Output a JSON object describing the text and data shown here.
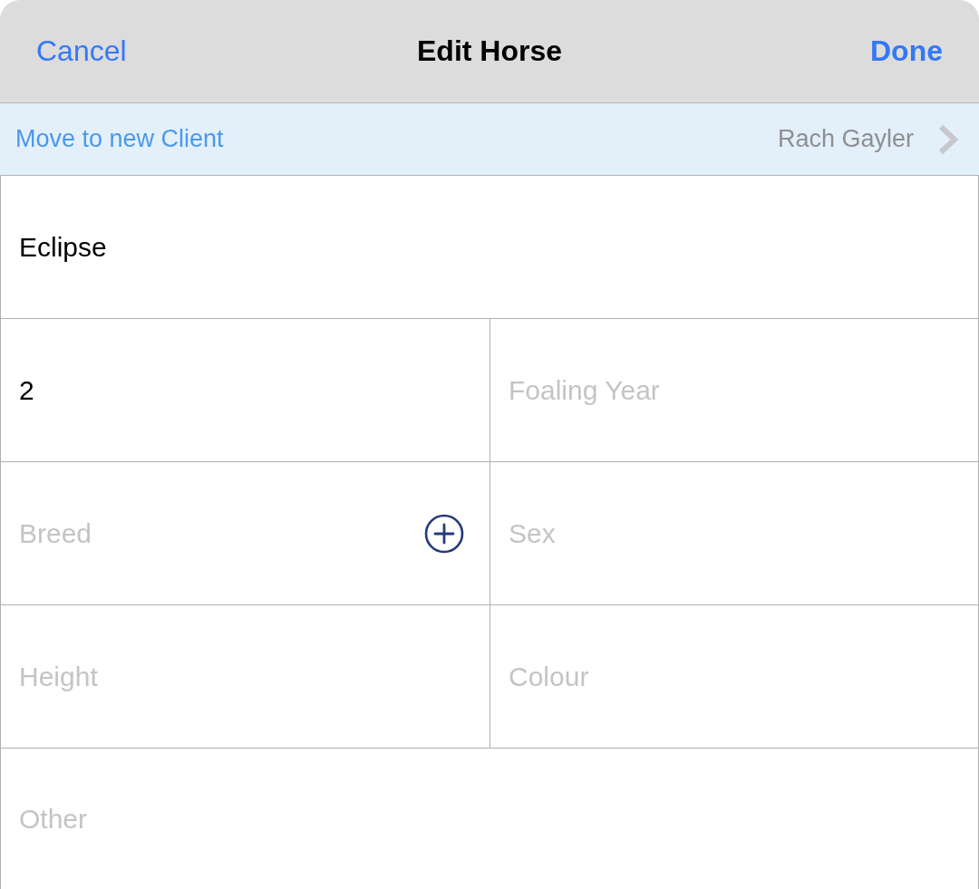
{
  "header": {
    "cancel": "Cancel",
    "title": "Edit Horse",
    "done": "Done"
  },
  "move_bar": {
    "label": "Move to new Client",
    "client": "Rach Gayler"
  },
  "rows": [
    [
      {
        "kind": "text",
        "value": "Eclipse"
      }
    ],
    [
      {
        "kind": "text",
        "value": "2"
      },
      {
        "kind": "text",
        "placeholder": "Foaling Year"
      }
    ],
    [
      {
        "kind": "add",
        "placeholder": "Breed"
      },
      {
        "kind": "text",
        "placeholder": "Sex"
      }
    ],
    [
      {
        "kind": "text",
        "placeholder": "Height"
      },
      {
        "kind": "text",
        "placeholder": "Colour"
      }
    ],
    [
      {
        "kind": "text",
        "placeholder": "Other"
      }
    ]
  ]
}
